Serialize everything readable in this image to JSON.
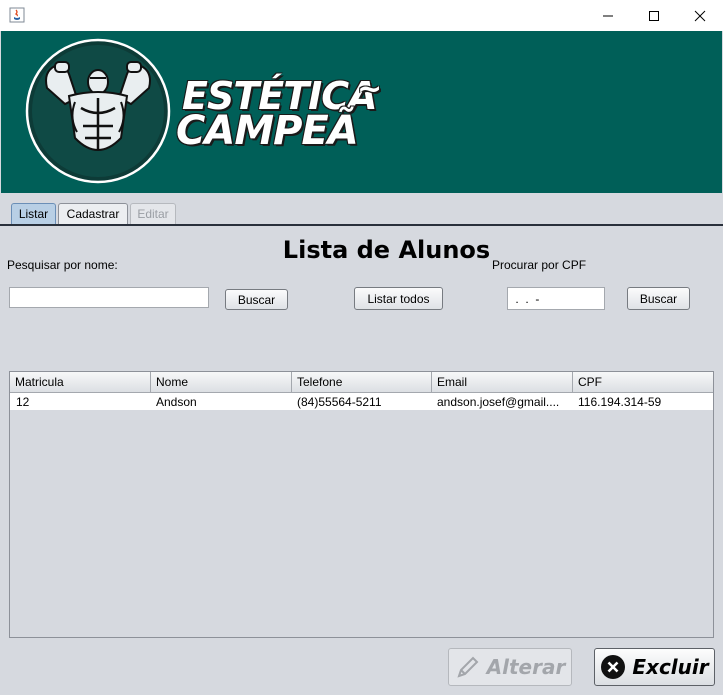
{
  "window": {
    "title": ""
  },
  "banner": {
    "brand_line1": "ESTÉTICA",
    "brand_tilde": "~",
    "brand_line2": "CAMPEÃ"
  },
  "tabs": [
    {
      "label": "Listar",
      "state": "selected"
    },
    {
      "label": "Cadastrar",
      "state": "normal"
    },
    {
      "label": "Editar",
      "state": "disabled"
    }
  ],
  "main": {
    "title": "Lista de Alunos",
    "search_name_label": "Pesquisar por nome:",
    "search_name_value": "",
    "buscar_label": "Buscar",
    "listar_todos_label": "Listar todos",
    "cpf_label": "Procurar por CPF",
    "cpf_value": " .  .  -",
    "buscar_cpf_label": "Buscar"
  },
  "table": {
    "columns": [
      "Matricula",
      "Nome",
      "Telefone",
      "Email",
      "CPF"
    ],
    "rows": [
      [
        "12",
        "Andson",
        "(84)55564-5211",
        "andson.josef@gmail....",
        "116.194.314-59"
      ]
    ]
  },
  "actions": {
    "alterar_label": "Alterar",
    "excluir_label": "Excluir"
  },
  "colors": {
    "banner": "#005f58",
    "background": "#d6d9df",
    "selected_tab": "#b8cfe5"
  }
}
